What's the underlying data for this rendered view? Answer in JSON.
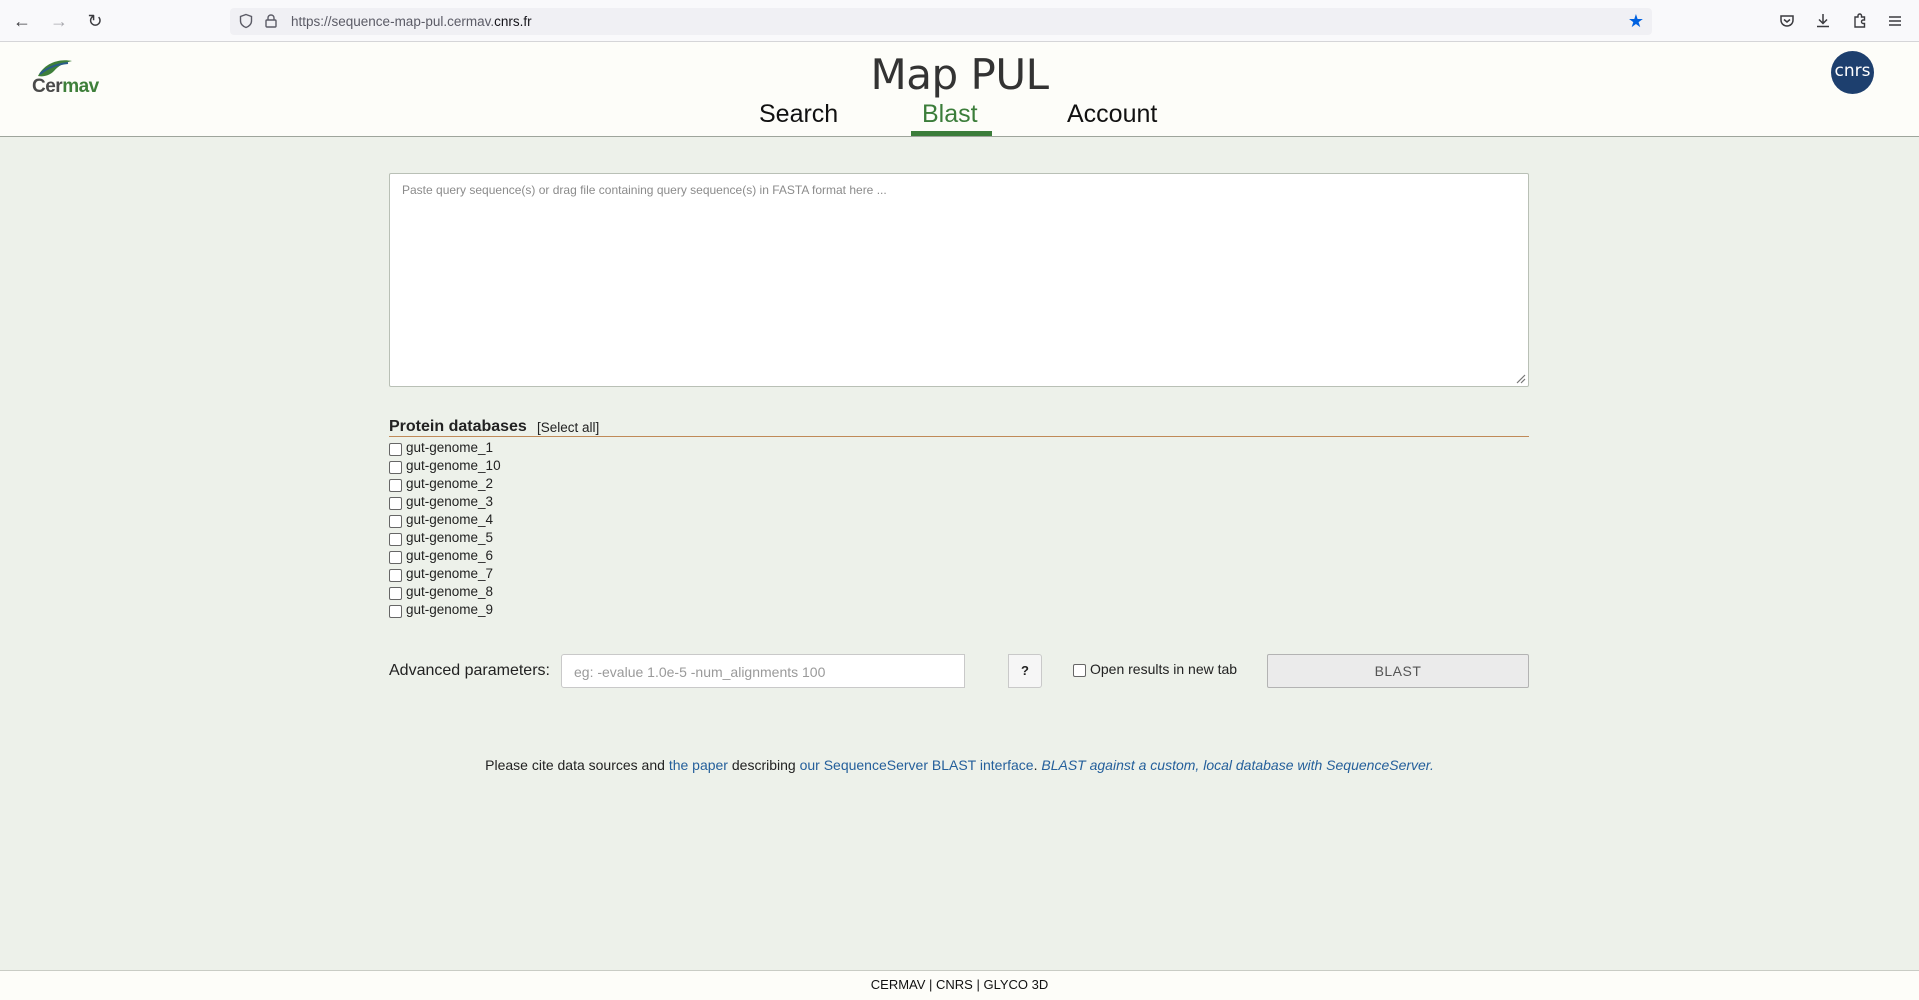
{
  "browser": {
    "url_prefix": "https://sequence-map-pul.cermav.",
    "url_domain": "cnrs.fr"
  },
  "header": {
    "logo_text_a": "Cer",
    "logo_text_b": "mav",
    "title": "Map PUL",
    "nav": [
      {
        "label": "Search"
      },
      {
        "label": "Blast"
      },
      {
        "label": "Account"
      }
    ],
    "cnrs_logo": "cnrs"
  },
  "query": {
    "placeholder": "Paste query sequence(s) or drag file containing query sequence(s) in FASTA format here ..."
  },
  "databases": {
    "title": "Protein databases",
    "select_all": "[Select all]",
    "items": [
      "gut-genome_1",
      "gut-genome_10",
      "gut-genome_2",
      "gut-genome_3",
      "gut-genome_4",
      "gut-genome_5",
      "gut-genome_6",
      "gut-genome_7",
      "gut-genome_8",
      "gut-genome_9"
    ]
  },
  "advanced": {
    "label": "Advanced parameters:",
    "placeholder": "eg: -evalue 1.0e-5 -num_alignments 100",
    "help": "?",
    "newtab_label": "Open results in new tab",
    "submit": "BLAST"
  },
  "cite": {
    "t1": "Please cite data sources and ",
    "link1": "the paper",
    "t2": " describing ",
    "link2": "our SequenceServer BLAST interface",
    "t3": ". ",
    "italic": "BLAST against a custom, local database with SequenceServer."
  },
  "footer": {
    "text": "CERMAV | CNRS | GLYCO 3D"
  }
}
